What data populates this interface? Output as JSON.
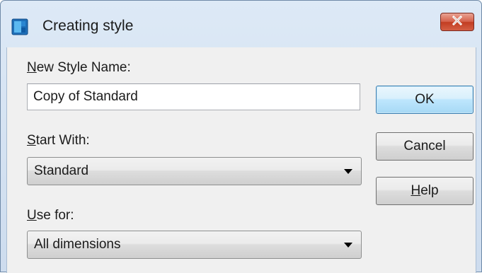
{
  "window": {
    "title": "Creating style",
    "close_icon": "close-x-icon",
    "app_icon": "app-logo-icon"
  },
  "fields": {
    "new_style_name": {
      "label_mnemonic": "N",
      "label_rest": "ew Style Name:",
      "value": "Copy of Standard"
    },
    "start_with": {
      "label_mnemonic": "S",
      "label_rest": "tart With:",
      "selected": "Standard"
    },
    "use_for": {
      "label_mnemonic": "U",
      "label_rest": "se for:",
      "selected": "All dimensions"
    }
  },
  "buttons": {
    "ok": "OK",
    "cancel": "Cancel",
    "help_mnemonic": "H",
    "help_rest": "elp"
  },
  "colors": {
    "titlebar": "#dde9f6",
    "close_button": "#c9472d",
    "client_background": "#f0f0f0",
    "default_button": "#bee6fd"
  }
}
